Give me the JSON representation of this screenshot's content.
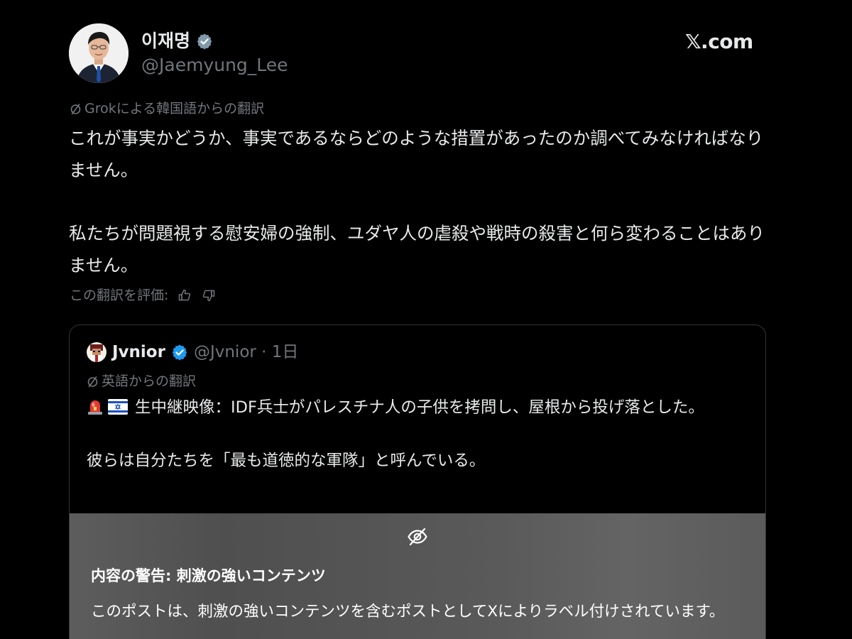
{
  "header": {
    "author_name": "이재명",
    "author_handle": "@Jaemyung_Lee",
    "site_logo": "𝕏.com",
    "verified_color": "#829aab",
    "avatar_icon": "profile-photo"
  },
  "tweet": {
    "translation_label": "Grokによる韓国語からの翻訳",
    "paragraphs": [
      "これが事実かどうか、事実であるならどのような措置があったのか調べてみなければなりません。",
      "私たちが問題視する慰安婦の強制、ユダヤ人の虐殺や戦時の殺害と何ら変わることはありません。"
    ],
    "rate_label": "この翻訳を評価:",
    "rate_icons": [
      "thumbs-up-icon",
      "thumbs-down-icon"
    ]
  },
  "quote": {
    "name": "Jvnior",
    "handle_time": "@Jvnior · 1日",
    "verified_color": "#1d9bf0",
    "translation_label": "英語からの翻訳",
    "emoji_siren": "🚨",
    "emoji_flag": "🇮🇱",
    "line1": "生中継映像：IDF兵士がパレスチナ人の子供を拷問し、屋根から投げ落とした。",
    "line2": "彼らは自分たちを「最も道徳的な軍隊」と呼んでいる。"
  },
  "warning": {
    "icon": "eye-off-icon",
    "title": "内容の警告: 刺激の強いコンテンツ",
    "text": "このポストは、刺激の強いコンテンツを含むポストとしてXによりラベル付けされています。"
  }
}
